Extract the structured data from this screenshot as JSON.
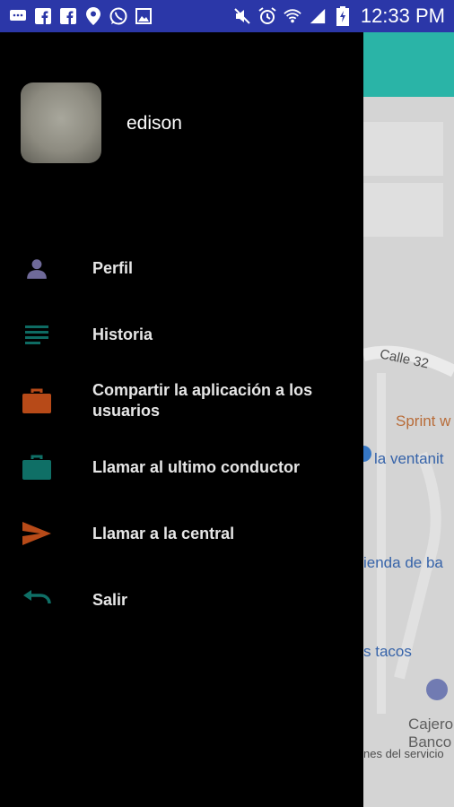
{
  "status_bar": {
    "time": "12:33 PM",
    "left_icons": [
      "message-icon",
      "facebook-icon",
      "facebook-icon",
      "location-pin-icon",
      "whatsapp-icon",
      "image-icon"
    ],
    "right_icons": [
      "mute-icon",
      "alarm-icon",
      "wifi-icon",
      "signal-icon",
      "battery-charging-icon"
    ]
  },
  "drawer": {
    "username": "edison",
    "menu": [
      {
        "label": "Perfil",
        "icon": "person-icon",
        "color": "#6f6a99"
      },
      {
        "label": "Historia",
        "icon": "list-icon",
        "color": "#0e6b63"
      },
      {
        "label": "Compartir la aplicación a los usuarios",
        "icon": "briefcase-icon",
        "color": "#b74a18"
      },
      {
        "label": "Llamar al ultimo conductor",
        "icon": "briefcase-icon",
        "color": "#0f6f66"
      },
      {
        "label": "Llamar a la central",
        "icon": "send-icon",
        "color": "#b74a18"
      },
      {
        "label": "Salir",
        "icon": "undo-icon",
        "color": "#0f6f66"
      }
    ]
  },
  "background_map": {
    "street": "Calle 32",
    "place1": "Sprint w",
    "place2": "la ventanit",
    "place3": "ienda de ba",
    "place4": "s tacos",
    "place5a": "Cajero",
    "place5b": "Banco",
    "footer": "nes del servicio"
  },
  "colors": {
    "status_bar": "#2b37a8",
    "drawer_bg": "#000000",
    "app_bar": "#2ec4b6"
  }
}
